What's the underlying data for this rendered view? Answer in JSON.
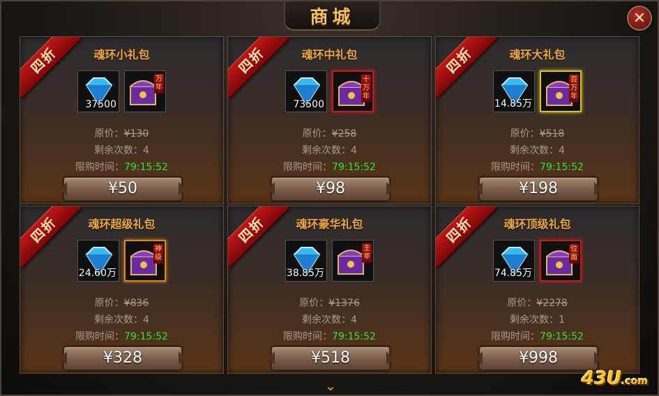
{
  "window": {
    "title": "商城",
    "close_label": "✕"
  },
  "ribbon_label": "四折",
  "labels": {
    "original_price": "原价：",
    "remaining": "剩余次数：",
    "time_limit": "限购时间："
  },
  "currency": "¥",
  "cards": [
    {
      "title": "魂环小礼包",
      "gem_qty": "37500",
      "tier": "万年",
      "orig": "130",
      "remaining": "4",
      "timer": "79:15:52",
      "price": "¥50"
    },
    {
      "title": "魂环中礼包",
      "gem_qty": "73500",
      "tier": "十万年",
      "orig": "258",
      "remaining": "4",
      "timer": "79:15:52",
      "price": "¥98"
    },
    {
      "title": "魂环大礼包",
      "gem_qty": "14.85万",
      "tier": "百万年",
      "orig": "518",
      "remaining": "4",
      "timer": "79:15:52",
      "price": "¥198"
    },
    {
      "title": "魂环超级礼包",
      "gem_qty": "24.60万",
      "tier": "神级",
      "orig": "836",
      "remaining": "4",
      "timer": "79:15:52",
      "price": "¥328"
    },
    {
      "title": "魂环豪华礼包",
      "gem_qty": "38.85万",
      "tier": "主宰",
      "orig": "1376",
      "remaining": "4",
      "timer": "79:15:52",
      "price": "¥518"
    },
    {
      "title": "魂环顶级礼包",
      "gem_qty": "74.85万",
      "tier": "位面",
      "orig": "2278",
      "remaining": "1",
      "timer": "79:15:52",
      "price": "¥998"
    }
  ],
  "footer": {
    "arrow": "⌄"
  },
  "watermark": {
    "text": "43U",
    "suffix": ".com"
  },
  "colors": {
    "accent": "#f0a93a",
    "timer": "#2ee82e",
    "ribbon": "#c01515"
  },
  "icons": {
    "gem": "blue-diamond-icon",
    "chest": "purple-chest-icon"
  }
}
